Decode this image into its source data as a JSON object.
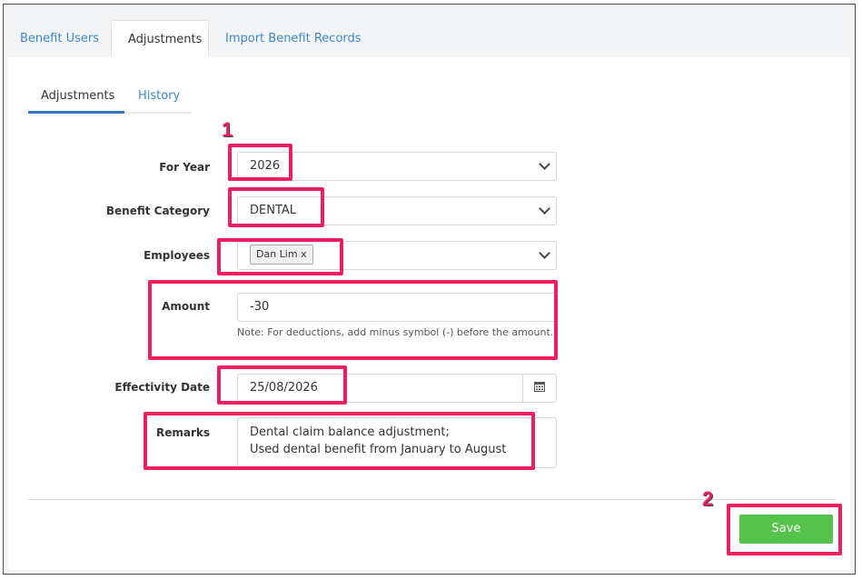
{
  "tabs": [
    {
      "label": "Benefit Users",
      "active": false
    },
    {
      "label": "Adjustments",
      "active": true
    },
    {
      "label": "Import Benefit Records",
      "active": false
    }
  ],
  "subtabs": [
    {
      "label": "Adjustments",
      "active": true
    },
    {
      "label": "History",
      "active": false
    }
  ],
  "form": {
    "for_year": {
      "label": "For Year",
      "value": "2026"
    },
    "benefit_category": {
      "label": "Benefit Category",
      "value": "DENTAL"
    },
    "employees": {
      "label": "Employees",
      "tag": "Dan Lim",
      "tag_remove": "x"
    },
    "amount": {
      "label": "Amount",
      "value": "-30",
      "note": "Note: For deductions, add minus symbol (-) before the amount."
    },
    "effectivity_date": {
      "label": "Effectivity Date",
      "value": "25/08/2026"
    },
    "remarks": {
      "label": "Remarks",
      "line1": "Dental claim balance adjustment;",
      "line2": "Used dental benefit from January to August"
    }
  },
  "save_label": "Save",
  "annotations": {
    "step1": "1",
    "step2": "2",
    "highlight_color": "#ee1f5f"
  },
  "colors": {
    "link": "#3a87c9",
    "active_underline": "#2f78be",
    "save_button": "#54c24b"
  }
}
